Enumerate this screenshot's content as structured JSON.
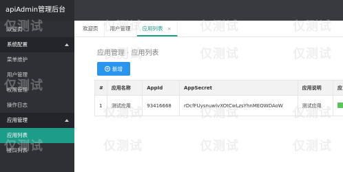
{
  "sidebar": {
    "brand": "apiAdmin管理后台",
    "items": [
      {
        "label": "欢迎页"
      },
      {
        "label": "系统配置",
        "group": true
      },
      {
        "label": "菜单维护"
      },
      {
        "label": "用户管理"
      },
      {
        "label": "权限管理"
      },
      {
        "label": "操作日志"
      },
      {
        "label": "应用管理",
        "group": true
      },
      {
        "label": "应用列表",
        "active": true
      },
      {
        "label": "接口列表"
      }
    ]
  },
  "tabs": [
    {
      "label": "欢迎页"
    },
    {
      "label": "用户管理"
    },
    {
      "label": "应用列表",
      "active": true,
      "close": "×"
    }
  ],
  "breadcrumb": "应用管理 · 应用列表",
  "add_button": {
    "label": "新增",
    "icon": "plus-icon"
  },
  "table": {
    "headers": [
      "#",
      "应用名称",
      "AppId",
      "AppSecret",
      "应用说明",
      "应"
    ],
    "rows": [
      {
        "index": "1",
        "name": "测试应用",
        "appid": "93416668",
        "secret": "rDcfFUysnuwlvXOtCwLzsYhnMEOWDAoW",
        "desc": "测试应用"
      }
    ]
  },
  "watermark": "仅测试",
  "colors": {
    "accent": "#1e9c8a",
    "primary_button": "#2a95ee",
    "sidebar_bg": "#2f3035",
    "status_green": "#5cc45c"
  }
}
